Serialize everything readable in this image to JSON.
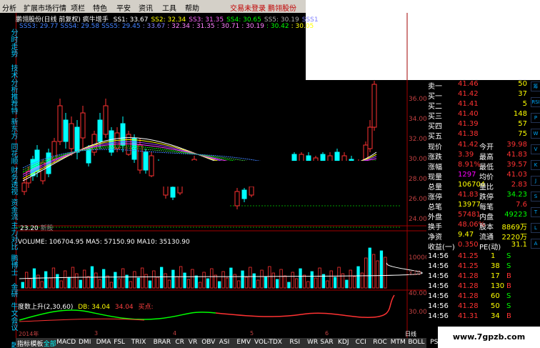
{
  "menu": [
    "分析",
    "扩展市场行情",
    "项栏",
    "特色",
    "平安",
    "资讯",
    "工具",
    "帮助"
  ],
  "menu_right": [
    "交易未登录",
    "鹏翎股份"
  ],
  "chart": {
    "title": "鹏翎股份(日线 前复权) 疯牛增手",
    "ss_line1": [
      {
        "t": "SS1: 33.67",
        "c": "#ffffff"
      },
      {
        "t": "SS2: 32.34",
        "c": "#ffff00"
      },
      {
        "t": "SS3: 31.35",
        "c": "#ff66ff"
      },
      {
        "t": "SS4: 30.65",
        "c": "#00ff00"
      },
      {
        "t": "SS5: 30.19",
        "c": "#aaaaaa"
      },
      {
        "t": "SSS1",
        "c": "#8080ff"
      }
    ],
    "ss_line2": [
      {
        "t": "SSS3: 29.77",
        "c": "#4080ff"
      },
      {
        "t": "SSS4: 29.58",
        "c": "#4080ff"
      },
      {
        "t": "SSS5: 29.45",
        "c": "#4080ff"
      },
      {
        "t": ": 33.67",
        "c": "#8080ff"
      },
      {
        "t": ": 32.34",
        "c": "#ff80ff"
      },
      {
        "t": ": 31.35",
        "c": "#ff80ff"
      },
      {
        "t": ": 30.71",
        "c": "#ff80ff"
      },
      {
        "t": ": 30.19",
        "c": "#ff80ff"
      },
      {
        "t": ": 30.42",
        "c": "#00ff00"
      },
      {
        "t": ": 30.05",
        "c": "#ffff00"
      },
      {
        "t": ": 29.9",
        "c": "#ffffff"
      }
    ],
    "low_label": "23.20",
    "low_suffix": "新股",
    "y_ticks": [
      "36.00",
      "34.00",
      "32.00",
      "30.00",
      "28.00",
      "26.00",
      "24.00"
    ],
    "volume_info": "VOLUME: 106704.95  MA5: 57150.90  MA10: 35130.90",
    "vol_ticks": [
      "10000",
      "X10"
    ],
    "indicator_label": "度数上升(2,30,60)",
    "indicator_db": "DB: 34.04",
    "indicator_val": "34.04",
    "indicator_buy": "买点:",
    "ind_ticks": [
      "40.00",
      "30.00"
    ],
    "date_labels": [
      "2014年",
      "3",
      "4",
      "5",
      "6"
    ],
    "period": "日线"
  },
  "left_tabs": [
    "分时走势",
    "技术分析",
    "推荐特",
    "新东方",
    "同花顺",
    "财务透视",
    "资金流",
    "主力对比",
    "鹏博士",
    "金研",
    "牛文会议",
    "散户"
  ],
  "quote": {
    "asks": [
      {
        "label": "卖一",
        "price": "41.46",
        "vol": "50"
      },
      {
        "label": "买一",
        "price": "41.42",
        "vol": "37"
      },
      {
        "label": "买二",
        "price": "41.41",
        "vol": "5"
      },
      {
        "label": "买三",
        "price": "41.40",
        "vol": "148"
      },
      {
        "label": "买四",
        "price": "41.39",
        "vol": "57"
      },
      {
        "label": "买五",
        "price": "41.38",
        "vol": "75"
      }
    ],
    "stats": [
      {
        "l1": "现价",
        "v1": "41.42",
        "l2": "今开",
        "v2": "39.98"
      },
      {
        "l1": "涨跌",
        "v1": "3.39",
        "l2": "最高",
        "v2": "41.83"
      },
      {
        "l1": "涨幅",
        "v1": "8.91%",
        "l2": "最低",
        "v2": "39.57"
      },
      {
        "l1": "现量",
        "v1": "1297",
        "l2": "均价",
        "v2": "41.03"
      },
      {
        "l1": "总量",
        "v1": "106704",
        "l2": "量比",
        "v2": "2.83"
      },
      {
        "l1": "涨停",
        "v1": "41.83",
        "l2": "跌停",
        "v2": "34.23"
      },
      {
        "l1": "总笔",
        "v1": "13977",
        "l2": "每笔",
        "v2": "7.6"
      },
      {
        "l1": "外盘",
        "v1": "57481",
        "l2": "内盘",
        "v2": "49223"
      },
      {
        "l1": "换手",
        "v1": "48.06%",
        "l2": "股本",
        "v2": "8869万"
      },
      {
        "l1": "净资",
        "v1": "9.47",
        "l2": "流通",
        "v2": "2220万"
      },
      {
        "l1": "收益(一)",
        "v1": "0.350",
        "l2": "PE(动)",
        "v2": "31.1"
      }
    ],
    "ticks": [
      {
        "time": "14:56",
        "price": "41.25",
        "vol": "1",
        "side": "S"
      },
      {
        "time": "14:56",
        "price": "41.25",
        "vol": "38",
        "side": "S"
      },
      {
        "time": "14:56",
        "price": "41.28",
        "vol": "17",
        "side": "B"
      },
      {
        "time": "14:56",
        "price": "41.28",
        "vol": "130",
        "side": "B"
      },
      {
        "time": "14:56",
        "price": "41.28",
        "vol": "60",
        "side": "S"
      },
      {
        "time": "14:56",
        "price": "41.28",
        "vol": "50",
        "side": "S"
      },
      {
        "time": "14:56",
        "price": "41.31",
        "vol": "34",
        "side": "B"
      }
    ]
  },
  "bottom_tabs": [
    "指标",
    "模板",
    "全部",
    "MACD",
    "DMI",
    "DMA",
    "FSL",
    "TRIX",
    "BRAR",
    "CR",
    "VR",
    "OBV",
    "ASI",
    "EMV",
    "VOL-TDX",
    "RSI",
    "WR",
    "SAR",
    "KDJ",
    "CCI",
    "ROC",
    "MTM",
    "BOLL",
    "PSY",
    "MCST",
    "笔"
  ],
  "right_icons": [
    "筹",
    "RSI",
    "P",
    "W",
    "V",
    "K",
    "J",
    "S",
    "T",
    "L",
    "A"
  ],
  "watermark": "www.7gpzb.com",
  "colors": {
    "up": "#ff3232",
    "down": "#00ffff",
    "bg": "#000000",
    "ma_yellow": "#ffff00",
    "ma_green": "#00ff00",
    "ma_purple": "#a040ff"
  }
}
